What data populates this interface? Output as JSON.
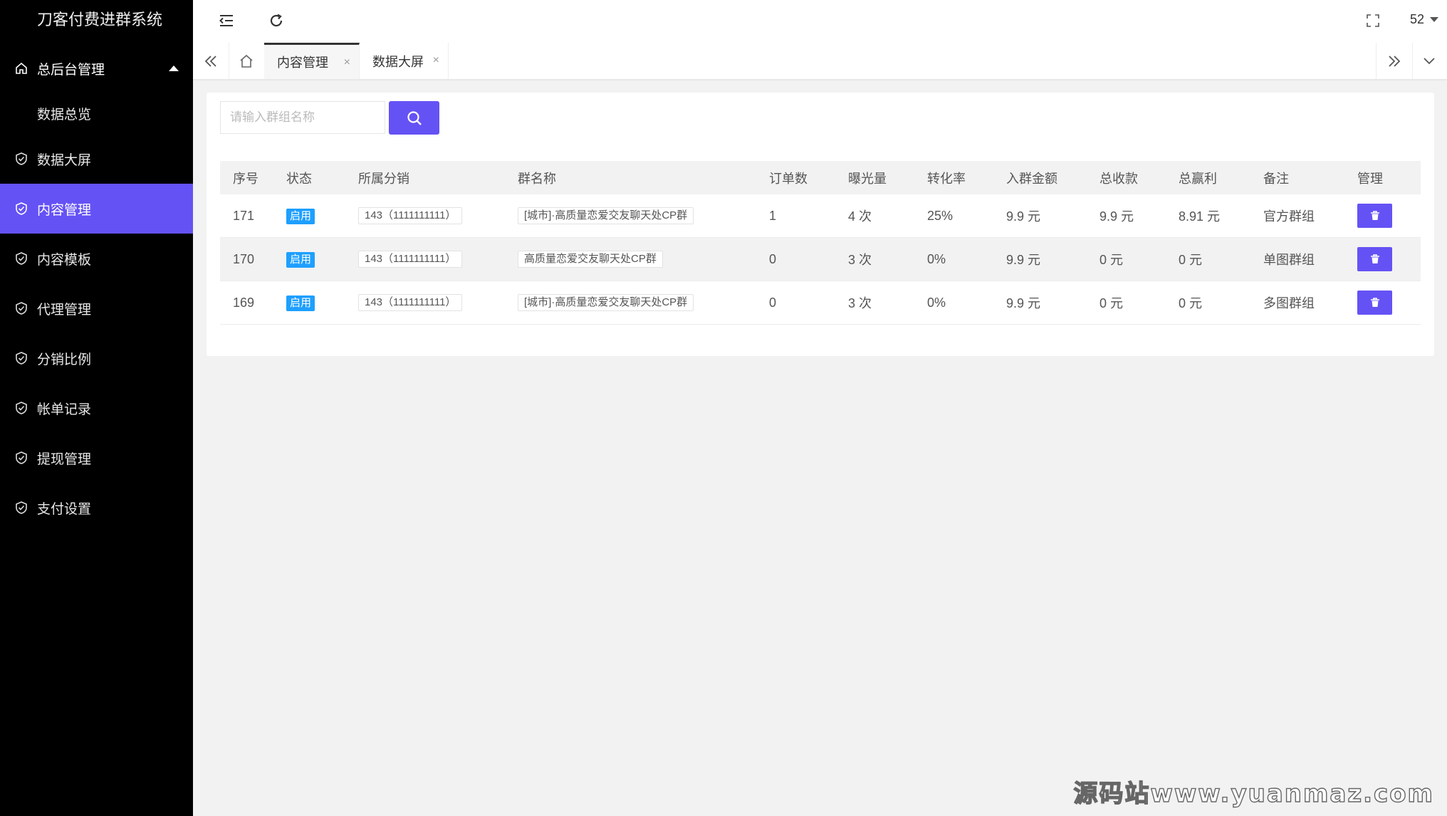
{
  "app_title": "刀客付费进群系统",
  "sidebar": {
    "group": {
      "label": "总后台管理",
      "icon": "home-icon",
      "expanded": true
    },
    "sub_items": [
      {
        "label": "数据总览"
      }
    ],
    "items": [
      {
        "label": "数据大屏",
        "icon": "shield-check-icon",
        "active": false
      },
      {
        "label": "内容管理",
        "icon": "shield-check-icon",
        "active": true
      },
      {
        "label": "内容模板",
        "icon": "shield-check-icon",
        "active": false
      },
      {
        "label": "代理管理",
        "icon": "shield-check-icon",
        "active": false
      },
      {
        "label": "分销比例",
        "icon": "shield-check-icon",
        "active": false
      },
      {
        "label": "帐单记录",
        "icon": "shield-check-icon",
        "active": false
      },
      {
        "label": "提现管理",
        "icon": "shield-check-icon",
        "active": false
      },
      {
        "label": "支付设置",
        "icon": "shield-check-icon",
        "active": false
      }
    ]
  },
  "topbar": {
    "toggle_icon": "menu-fold-icon",
    "refresh_icon": "refresh-icon",
    "fullscreen_icon": "fullscreen-icon",
    "user": "52"
  },
  "tabs": [
    {
      "label": "内容管理",
      "active": true
    },
    {
      "label": "数据大屏",
      "active": false
    }
  ],
  "tab_close_glyph": "×",
  "search": {
    "placeholder": "请输入群组名称",
    "button_icon": "search-icon"
  },
  "table": {
    "headers": [
      "序号",
      "状态",
      "所属分销",
      "群名称",
      "订单数",
      "曝光量",
      "转化率",
      "入群金额",
      "总收款",
      "总赢利",
      "备注",
      "管理"
    ],
    "rows": [
      {
        "id": "171",
        "status": "启用",
        "distributor": "143（1111111111）",
        "group_name": "[城市]·高质量恋爱交友聊天处CP群",
        "orders": "1",
        "exposure": "4 次",
        "conversion": "25%",
        "fee": "9.9 元",
        "income": "9.9 元",
        "profit": "8.91 元",
        "note": "官方群组"
      },
      {
        "id": "170",
        "status": "启用",
        "distributor": "143（1111111111）",
        "group_name": "高质量恋爱交友聊天处CP群",
        "orders": "0",
        "exposure": "3 次",
        "conversion": "0%",
        "fee": "9.9 元",
        "income": "0 元",
        "profit": "0 元",
        "note": "单图群组"
      },
      {
        "id": "169",
        "status": "启用",
        "distributor": "143（1111111111）",
        "group_name": "[城市]·高质量恋爱交友聊天处CP群",
        "orders": "0",
        "exposure": "3 次",
        "conversion": "0%",
        "fee": "9.9 元",
        "income": "0 元",
        "profit": "0 元",
        "note": "多图群组"
      }
    ]
  },
  "colors": {
    "accent": "#6552f5",
    "badge": "#1e9fff",
    "sidebar_bg": "#000000"
  },
  "watermark": "源码站www.yuanmaz.com"
}
